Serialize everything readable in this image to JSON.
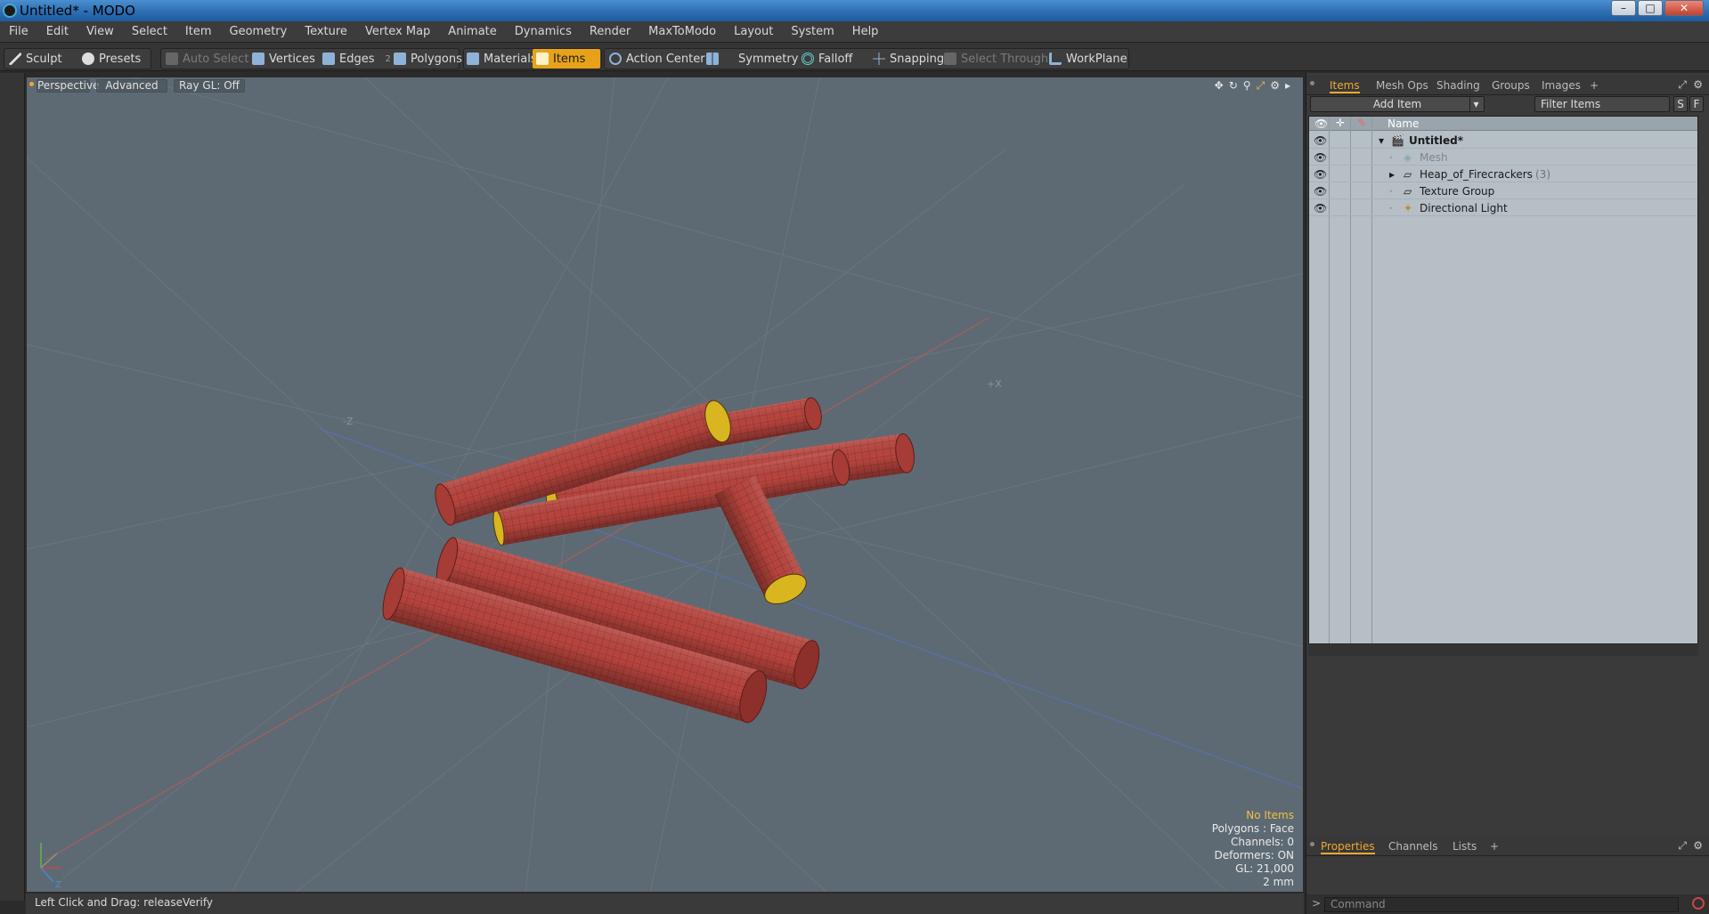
{
  "window": {
    "title": "Untitled* - MODO",
    "minimize": "–",
    "maximize": "□",
    "close": "✕"
  },
  "menu": [
    "File",
    "Edit",
    "View",
    "Select",
    "Item",
    "Geometry",
    "Texture",
    "Vertex Map",
    "Animate",
    "Dynamics",
    "Render",
    "MaxToModo",
    "Layout",
    "System",
    "Help"
  ],
  "toolbar": {
    "sculpt": "Sculpt",
    "presets": "Presets",
    "auto_select": "Auto Select",
    "vertices": "Vertices",
    "edges": "Edges",
    "edges_key": "2",
    "polygons": "Polygons",
    "materials": "Materials",
    "items": "Items",
    "items_key": "5",
    "action_center": "Action Center",
    "symmetry": "Symmetry",
    "falloff": "Falloff",
    "snapping": "Snapping",
    "select_through": "Select Through",
    "workplane": "WorkPlane"
  },
  "viewport": {
    "view_name": "Perspective",
    "shading": "Advanced",
    "raygl": "Ray GL: Off",
    "hud": {
      "selection": "No Items",
      "polygons": "Polygons : Face",
      "channels": "Channels: 0",
      "deformers": "Deformers: ON",
      "gl": "GL: 21,000",
      "grid": "2 mm"
    },
    "axis_labels": {
      "x": "+X",
      "z": "-Z",
      "y": "Y",
      "z2": "Z"
    }
  },
  "status": {
    "text": "Left Click and Drag:  releaseVerify"
  },
  "items_panel": {
    "tabs": [
      "Items",
      "Mesh Ops",
      "Shading",
      "Groups",
      "Images",
      "+"
    ],
    "add_item": "Add Item",
    "filter_placeholder": "Filter Items",
    "btn_s": "S",
    "btn_f": "F",
    "column_name": "Name",
    "rows": [
      {
        "name": "Untitled*",
        "bold": true,
        "count": ""
      },
      {
        "name": "Mesh",
        "dim": true,
        "count": ""
      },
      {
        "name": "Heap_of_Firecrackers",
        "count": "(3)"
      },
      {
        "name": "Texture Group",
        "count": ""
      },
      {
        "name": "Directional Light",
        "count": ""
      }
    ]
  },
  "bottom_panel": {
    "tabs": [
      "Properties",
      "Channels",
      "Lists",
      "+"
    ],
    "command_placeholder": "Command",
    "prompt": ">"
  },
  "colors": {
    "accent": "#e7a21a",
    "viewport_bg": "#5e6a73",
    "firecracker": "#b8453e",
    "fuse_cap": "#d9b51f"
  }
}
